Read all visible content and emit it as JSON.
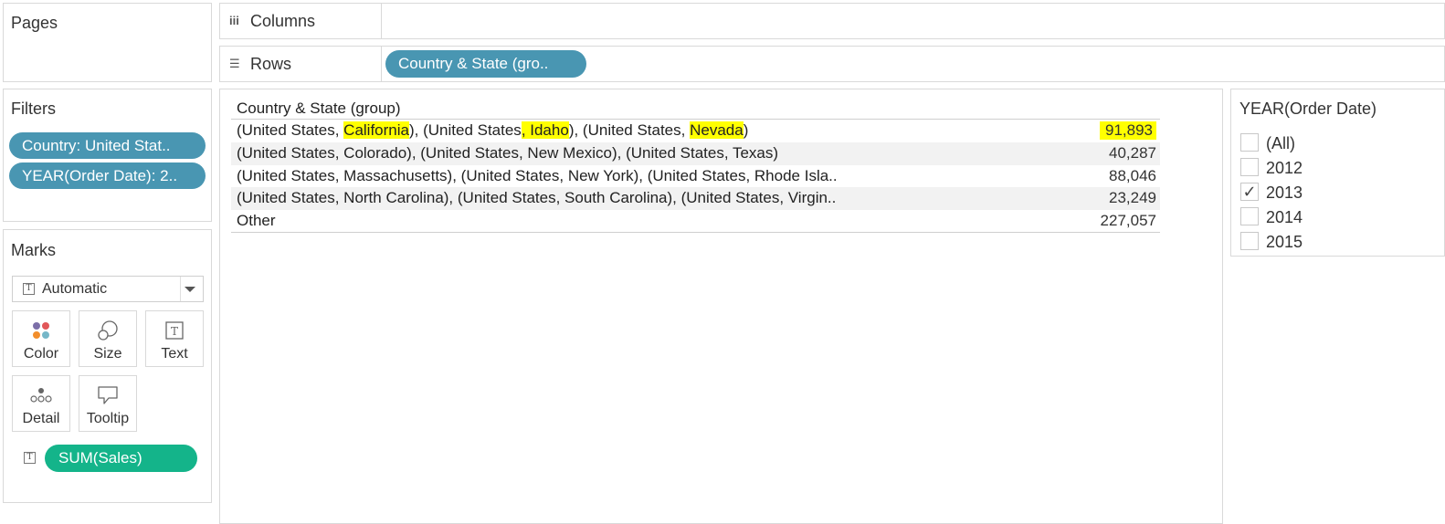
{
  "pages": {
    "title": "Pages"
  },
  "filters": {
    "title": "Filters",
    "pills": [
      "Country: United Stat..",
      "YEAR(Order Date): 2.."
    ]
  },
  "marks": {
    "title": "Marks",
    "mark_type": "Automatic",
    "buttons": {
      "color": "Color",
      "size": "Size",
      "text": "Text",
      "detail": "Detail",
      "tooltip": "Tooltip"
    },
    "pill": "SUM(Sales)",
    "pill_color": "#14b48a"
  },
  "shelves": {
    "columns_label": "Columns",
    "rows_label": "Rows",
    "rows_pill": "Country & State (gro.."
  },
  "view": {
    "column_header": "Country & State (group)",
    "rows": [
      {
        "label_parts": [
          "(United States, ",
          "California",
          "), (United States",
          ", Idaho",
          "), (United States, ",
          "Nevada",
          ")"
        ],
        "value": "91,893"
      },
      {
        "label": "(United States, Colorado), (United States, New Mexico), (United States, Texas)",
        "value": "40,287"
      },
      {
        "label": "(United States, Massachusetts), (United States, New York), (United States, Rhode Isla..",
        "value": "88,046"
      },
      {
        "label": "(United States, North Carolina), (United States, South Carolina), (United States, Virgin..",
        "value": "23,249"
      },
      {
        "label": "Other",
        "value": "227,057"
      }
    ],
    "highlight_color": "#ffff00"
  },
  "year_filter": {
    "title": "YEAR(Order Date)",
    "options": [
      {
        "label": "(All)",
        "checked": false
      },
      {
        "label": "2012",
        "checked": false
      },
      {
        "label": "2013",
        "checked": true
      },
      {
        "label": "2014",
        "checked": false
      },
      {
        "label": "2015",
        "checked": false
      }
    ],
    "check_glyph": "✓"
  },
  "colors": {
    "pill_blue": "#4996b2",
    "pill_green": "#14b48a"
  }
}
